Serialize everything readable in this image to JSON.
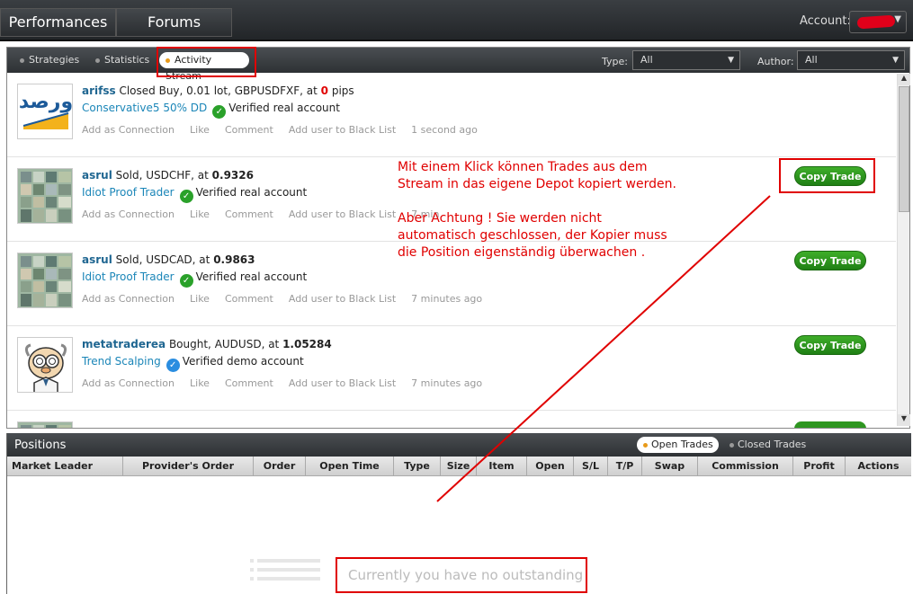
{
  "topnav": {
    "performances": "Performances",
    "forums": "Forums",
    "account_label": "Account:"
  },
  "subtabs": {
    "strategies": "Strategies",
    "statistics": "Statistics",
    "activity": "Activity Stream"
  },
  "filters": {
    "type_label": "Type:",
    "type_value": "All",
    "author_label": "Author:",
    "author_value": "All"
  },
  "feed": [
    {
      "author": "arifss",
      "action": "Closed Buy, 0.01 lot, GBPUSDFXF, at",
      "value": "0",
      "suffix": "pips",
      "strategy": "Conservative5 50% DD",
      "verified": "Verified real account",
      "time": "1 second ago",
      "copy": ""
    },
    {
      "author": "asrul",
      "action": "Sold, USDCHF, at",
      "value": "0.9326",
      "suffix": "",
      "strategy": "Idiot Proof Trader",
      "verified": "Verified real account",
      "time": "7 min",
      "copy": "Copy Trade"
    },
    {
      "author": "asrul",
      "action": "Sold, USDCAD, at",
      "value": "0.9863",
      "suffix": "",
      "strategy": "Idiot Proof Trader",
      "verified": "Verified real account",
      "time": "7 minutes ago",
      "copy": "Copy Trade"
    },
    {
      "author": "metatraderea",
      "action": "Bought, AUDUSD, at",
      "value": "1.05284",
      "suffix": "",
      "strategy": "Trend Scalping",
      "verified": "Verified demo account",
      "time": "7 minutes ago",
      "copy": "Copy Trade"
    }
  ],
  "feed_actions": {
    "connection": "Add as Connection",
    "like": "Like",
    "comment": "Comment",
    "blacklist": "Add user to Black List"
  },
  "annotations": {
    "line1": "Mit einem Klick können Trades aus dem",
    "line2": "Stream in das eigene Depot kopiert werden.",
    "line3": "Aber Achtung ! Sie werden nicht",
    "line4": "automatisch geschlossen, der Kopier muss",
    "line5": "die Position eigenständig überwachen ."
  },
  "positions": {
    "title": "Positions",
    "open_tab": "Open Trades",
    "closed_tab": "Closed Trades",
    "columns": [
      "Market Leader",
      "Provider's Order",
      "Order",
      "Open Time",
      "Type",
      "Size",
      "Item",
      "Open",
      "S/L",
      "T/P",
      "Swap",
      "Commission",
      "Profit",
      "Actions"
    ],
    "empty_text": "Currently you have no outstanding"
  },
  "colors": {
    "accent_red": "#e00000",
    "link_blue": "#1f6691",
    "verified_green": "#2aa12a",
    "copy_green": "#2e9620"
  }
}
